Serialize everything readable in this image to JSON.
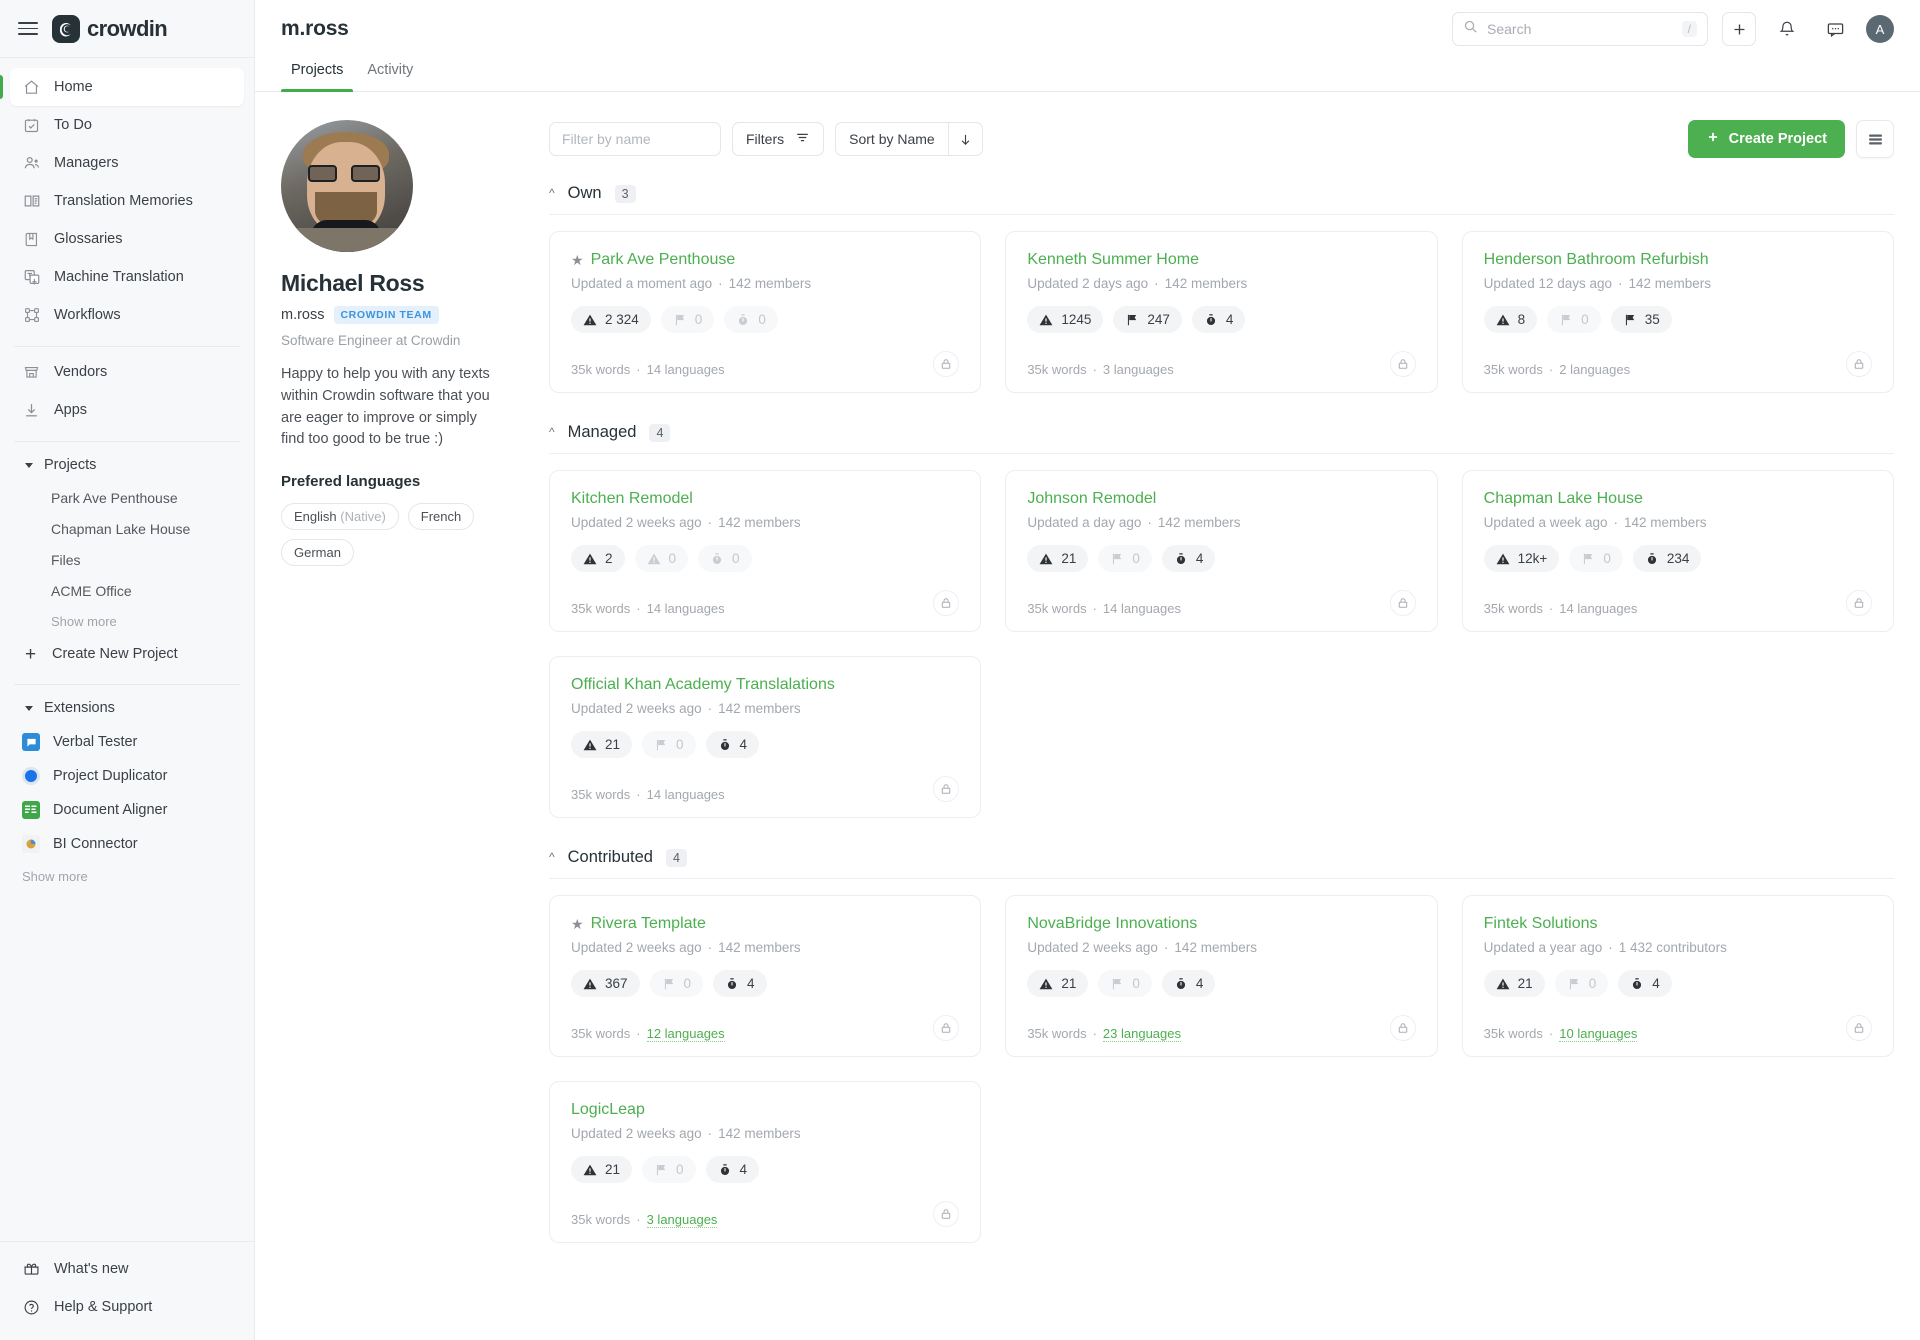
{
  "app": {
    "brand": "crowdin"
  },
  "sidebar": {
    "nav": [
      {
        "label": "Home",
        "icon": "home-icon",
        "active": true
      },
      {
        "label": "To Do",
        "icon": "todo-icon",
        "active": false
      },
      {
        "label": "Managers",
        "icon": "managers-icon",
        "active": false
      },
      {
        "label": "Translation Memories",
        "icon": "translation-memories-icon",
        "active": false
      },
      {
        "label": "Glossaries",
        "icon": "glossaries-icon",
        "active": false
      },
      {
        "label": "Machine Translation",
        "icon": "machine-translation-icon",
        "active": false
      },
      {
        "label": "Workflows",
        "icon": "workflows-icon",
        "active": false
      }
    ],
    "nav2": [
      {
        "label": "Vendors",
        "icon": "vendors-icon"
      },
      {
        "label": "Apps",
        "icon": "apps-icon"
      }
    ],
    "projects_section": {
      "label": "Projects",
      "items": [
        "Park Ave Penthouse",
        "Chapman Lake House",
        "Files",
        "ACME Office"
      ],
      "show_more": "Show more",
      "create": "Create New Project"
    },
    "extensions_section": {
      "label": "Extensions",
      "items": [
        {
          "label": "Verbal Tester",
          "color": "#2e8bd8"
        },
        {
          "label": "Project Duplicator",
          "color": "#1a73e8"
        },
        {
          "label": "Document Aligner",
          "color": "#3fa74a"
        },
        {
          "label": "BI Connector",
          "color": "#d8a13a"
        }
      ],
      "show_more": "Show more"
    },
    "bottom": [
      {
        "label": "What's new",
        "icon": "whats-new-icon"
      },
      {
        "label": "Help & Support",
        "icon": "help-icon"
      }
    ]
  },
  "header": {
    "title": "m.ross",
    "search": {
      "placeholder": "Search",
      "value": "",
      "shortcut": "/"
    },
    "avatar_initial": "A"
  },
  "tabs": [
    {
      "label": "Projects",
      "active": true
    },
    {
      "label": "Activity",
      "active": false
    }
  ],
  "profile": {
    "name": "Michael Ross",
    "handle": "m.ross",
    "team_badge": "CROWDIN TEAM",
    "role": "Software Engineer at Crowdin",
    "bio": "Happy to help you with any texts within Crowdin software that you are eager to improve or simply find too good to be true :)",
    "preferred_languages_title": "Prefered languages",
    "languages": [
      {
        "name": "English",
        "note": "(Native)"
      },
      {
        "name": "French",
        "note": ""
      },
      {
        "name": "German",
        "note": ""
      }
    ]
  },
  "toolbar": {
    "filter_placeholder": "Filter by name",
    "filter_value": "",
    "filters_label": "Filters",
    "sort_label": "Sort by Name",
    "sort_direction": "desc",
    "create_label": "Create Project",
    "view_toggle": "list-view-icon"
  },
  "colors": {
    "accent_green": "#4caf50",
    "tab_underline": "#43ac4a",
    "team_badge_text": "#3c94de",
    "team_badge_bg": "#e4f0fb"
  },
  "groups": [
    {
      "name": "Own",
      "count": "3",
      "projects": [
        {
          "name": "Park Ave Penthouse",
          "starred": true,
          "updated": "Updated a moment ago",
          "members": "142 members",
          "badges": [
            {
              "icon": "warning-icon",
              "value": "2 324",
              "muted": false
            },
            {
              "icon": "flag-icon",
              "value": "0",
              "muted": true
            },
            {
              "icon": "stopwatch-icon",
              "value": "0",
              "muted": true
            }
          ],
          "words": "35k words",
          "languages": "14 languages",
          "languages_link": false,
          "private": true
        },
        {
          "name": "Kenneth Summer Home",
          "starred": false,
          "updated": "Updated 2 days ago",
          "members": "142 members",
          "badges": [
            {
              "icon": "warning-icon",
              "value": "1245",
              "muted": false
            },
            {
              "icon": "flag-icon",
              "value": "247",
              "muted": false
            },
            {
              "icon": "stopwatch-icon",
              "value": "4",
              "muted": false
            }
          ],
          "words": "35k words",
          "languages": "3 languages",
          "languages_link": false,
          "private": true
        },
        {
          "name": "Henderson Bathroom Refurbish",
          "starred": false,
          "updated": "Updated 12 days ago",
          "members": "142 members",
          "badges": [
            {
              "icon": "warning-icon",
              "value": "8",
              "muted": false
            },
            {
              "icon": "flag-icon",
              "value": "0",
              "muted": true
            },
            {
              "icon": "flag-icon",
              "value": "35",
              "muted": false
            }
          ],
          "words": "35k words",
          "languages": "2 languages",
          "languages_link": false,
          "private": true
        }
      ]
    },
    {
      "name": "Managed",
      "count": "4",
      "projects": [
        {
          "name": "Kitchen Remodel",
          "starred": false,
          "updated": "Updated 2 weeks ago",
          "members": "142 members",
          "badges": [
            {
              "icon": "warning-icon",
              "value": "2",
              "muted": false
            },
            {
              "icon": "warning-icon",
              "value": "0",
              "muted": true
            },
            {
              "icon": "stopwatch-icon",
              "value": "0",
              "muted": true
            }
          ],
          "words": "35k words",
          "languages": "14 languages",
          "languages_link": false,
          "private": true
        },
        {
          "name": "Johnson Remodel",
          "starred": false,
          "updated": "Updated a day ago",
          "members": "142 members",
          "badges": [
            {
              "icon": "warning-icon",
              "value": "21",
              "muted": false
            },
            {
              "icon": "flag-icon",
              "value": "0",
              "muted": true
            },
            {
              "icon": "stopwatch-icon",
              "value": "4",
              "muted": false
            }
          ],
          "words": "35k words",
          "languages": "14 languages",
          "languages_link": false,
          "private": true
        },
        {
          "name": "Chapman Lake House",
          "starred": false,
          "updated": "Updated a week ago",
          "members": "142 members",
          "badges": [
            {
              "icon": "warning-icon",
              "value": "12k+",
              "muted": false
            },
            {
              "icon": "flag-icon",
              "value": "0",
              "muted": true
            },
            {
              "icon": "stopwatch-icon",
              "value": "234",
              "muted": false
            }
          ],
          "words": "35k words",
          "languages": "14 languages",
          "languages_link": false,
          "private": true
        },
        {
          "name": "Official Khan Academy Translalations",
          "starred": false,
          "updated": "Updated 2 weeks ago",
          "members": "142 members",
          "badges": [
            {
              "icon": "warning-icon",
              "value": "21",
              "muted": false
            },
            {
              "icon": "flag-icon",
              "value": "0",
              "muted": true
            },
            {
              "icon": "stopwatch-icon",
              "value": "4",
              "muted": false
            }
          ],
          "words": "35k words",
          "languages": "14 languages",
          "languages_link": false,
          "private": true
        }
      ]
    },
    {
      "name": "Contributed",
      "count": "4",
      "projects": [
        {
          "name": "Rivera Template",
          "starred": true,
          "updated": "Updated 2 weeks ago",
          "members": "142 members",
          "badges": [
            {
              "icon": "warning-icon",
              "value": "367",
              "muted": false
            },
            {
              "icon": "flag-icon",
              "value": "0",
              "muted": true
            },
            {
              "icon": "stopwatch-icon",
              "value": "4",
              "muted": false
            }
          ],
          "words": "35k words",
          "languages": "12 languages",
          "languages_link": true,
          "private": true
        },
        {
          "name": "NovaBridge Innovations",
          "starred": false,
          "updated": "Updated 2 weeks ago",
          "members": "142 members",
          "badges": [
            {
              "icon": "warning-icon",
              "value": "21",
              "muted": false
            },
            {
              "icon": "flag-icon",
              "value": "0",
              "muted": true
            },
            {
              "icon": "stopwatch-icon",
              "value": "4",
              "muted": false
            }
          ],
          "words": "35k words",
          "languages": "23 languages",
          "languages_link": true,
          "private": true
        },
        {
          "name": "Fintek Solutions",
          "starred": false,
          "updated": "Updated a year ago",
          "members": "1 432 contributors",
          "badges": [
            {
              "icon": "warning-icon",
              "value": "21",
              "muted": false
            },
            {
              "icon": "flag-icon",
              "value": "0",
              "muted": true
            },
            {
              "icon": "stopwatch-icon",
              "value": "4",
              "muted": false
            }
          ],
          "words": "35k words",
          "languages": "10 languages",
          "languages_link": true,
          "private": true
        },
        {
          "name": "LogicLeap",
          "starred": false,
          "updated": "Updated 2 weeks ago",
          "members": "142 members",
          "badges": [
            {
              "icon": "warning-icon",
              "value": "21",
              "muted": false
            },
            {
              "icon": "flag-icon",
              "value": "0",
              "muted": true
            },
            {
              "icon": "stopwatch-icon",
              "value": "4",
              "muted": false
            }
          ],
          "words": "35k words",
          "languages": "3 languages",
          "languages_link": true,
          "private": true
        }
      ]
    }
  ]
}
